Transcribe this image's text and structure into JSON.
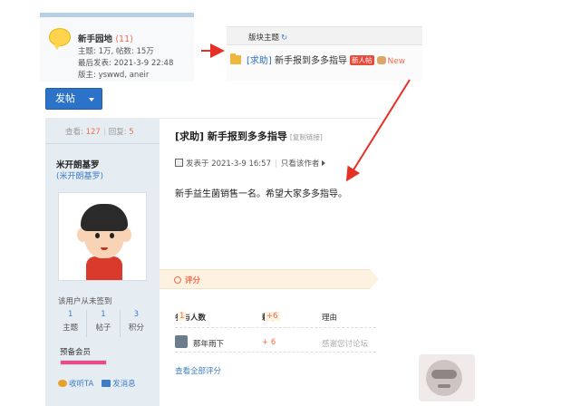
{
  "forum": {
    "name": "新手园地",
    "count": "(11)",
    "topics_line": "主题: 1万, 帖数: 15万",
    "last_post_line": "最后发表: 2021-3-9 22:48",
    "moderator_line": "版主: yswwd, aneir"
  },
  "block": {
    "header": "版块主题",
    "refresh_glyph": "↻",
    "tag": "[求助]",
    "title": "新手报到多多指导",
    "badge": "新人帖",
    "new_label": "New"
  },
  "post_button": {
    "label": "发帖"
  },
  "sidebar": {
    "views_label": "查看:",
    "views": "127",
    "replies_label": "回复:",
    "replies": "5",
    "username": "米开朗基罗",
    "nickname": "(米开朗基罗)",
    "sign_status": "该用户从未签到",
    "stats": [
      {
        "value": "1",
        "label": "主题"
      },
      {
        "value": "1",
        "label": "帖子"
      },
      {
        "value": "3",
        "label": "积分"
      }
    ],
    "member_level": "预备会员",
    "level_progress": 1.0,
    "follow_label": "收听TA",
    "message_label": "发消息"
  },
  "post": {
    "tag": "[求助]",
    "title": "新手报到多多指导",
    "copy_link": "[复制链接]",
    "posted_on": "发表于 2021-3-9 16:57",
    "only_author": "只看该作者",
    "content": "新手益生菌销售一名。希望大家多多指导。"
  },
  "rating": {
    "section_label": "评分",
    "participants_label": "参与人数",
    "participants": "1",
    "coins_label": "赖票",
    "coins_total": "+6",
    "reason_label": "理由",
    "rows": [
      {
        "user": "那年雨下",
        "score": "+ 6",
        "reason": "感谢您讨论坛"
      }
    ],
    "view_all": "查看全部评分"
  },
  "colors": {
    "accent_blue": "#2b73c9",
    "link_blue": "#3d7cc9",
    "orange": "#f26c4f",
    "annotation_red": "#e63025"
  }
}
